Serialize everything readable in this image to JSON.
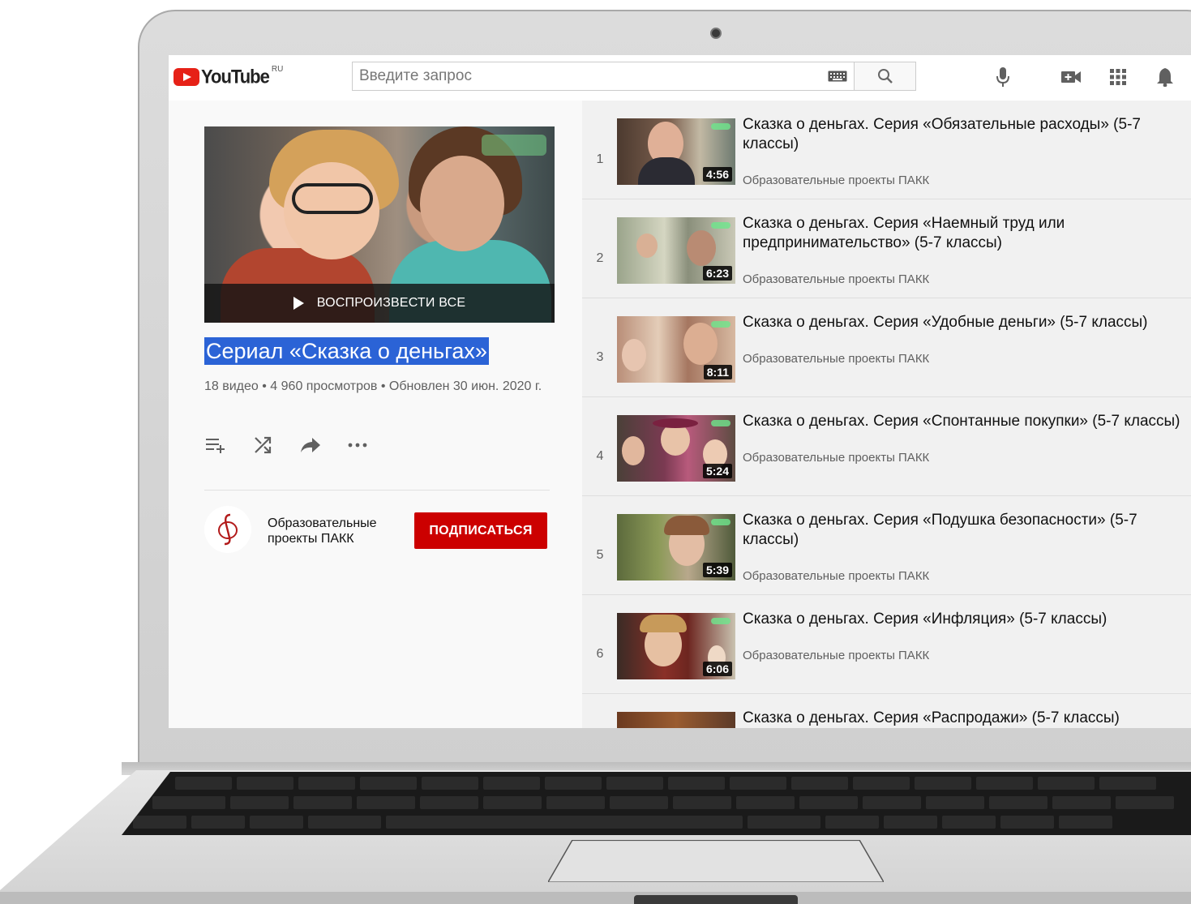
{
  "topbar": {
    "logo_text": "YouTube",
    "logo_region": "RU",
    "search_placeholder": "Введите запрос"
  },
  "playlist": {
    "play_all_label": "ВОСПРОИЗВЕСТИ ВСЕ",
    "title": "Сериал «Сказка о деньгах»",
    "meta": "18 видео • 4 960 просмотров • Обновлен 30 июн. 2020 г.",
    "channel_name": "Образовательные проекты ПАКК",
    "subscribe_label": "ПОДПИСАТЬСЯ",
    "accent_color": "#cc0000",
    "selection_color": "#2b63d6"
  },
  "videos": [
    {
      "index": "1",
      "title": "Сказка о деньгах. Серия «Обязательные расходы» (5-7 классы)",
      "channel": "Образовательные проекты ПАКК",
      "duration": "4:56"
    },
    {
      "index": "2",
      "title": "Сказка о деньгах. Серия «Наемный труд или предпринимательство» (5-7 классы)",
      "channel": "Образовательные проекты ПАКК",
      "duration": "6:23"
    },
    {
      "index": "3",
      "title": "Сказка о деньгах. Серия «Удобные деньги» (5-7 классы)",
      "channel": "Образовательные проекты ПАКК",
      "duration": "8:11"
    },
    {
      "index": "4",
      "title": "Сказка о деньгах. Серия «Спонтанные покупки» (5-7 классы)",
      "channel": "Образовательные проекты ПАКК",
      "duration": "5:24"
    },
    {
      "index": "5",
      "title": "Сказка о деньгах. Серия «Подушка безопасности» (5-7 классы)",
      "channel": "Образовательные проекты ПАКК",
      "duration": "5:39"
    },
    {
      "index": "6",
      "title": "Сказка о деньгах. Серия «Инфляция» (5-7 классы)",
      "channel": "Образовательные проекты ПАКК",
      "duration": "6:06"
    },
    {
      "index": "",
      "title": "Сказка о деньгах. Серия «Распродажи» (5-7 классы)",
      "channel": "",
      "duration": ""
    }
  ],
  "icons": {
    "keyboard": "keyboard-icon",
    "search": "search-icon",
    "mic": "mic-icon",
    "create": "video-camera-plus-icon",
    "apps": "apps-grid-icon",
    "notifications": "bell-icon",
    "add_to_queue": "add-to-queue-icon",
    "shuffle": "shuffle-icon",
    "share": "share-icon",
    "more": "more-dots-icon"
  }
}
